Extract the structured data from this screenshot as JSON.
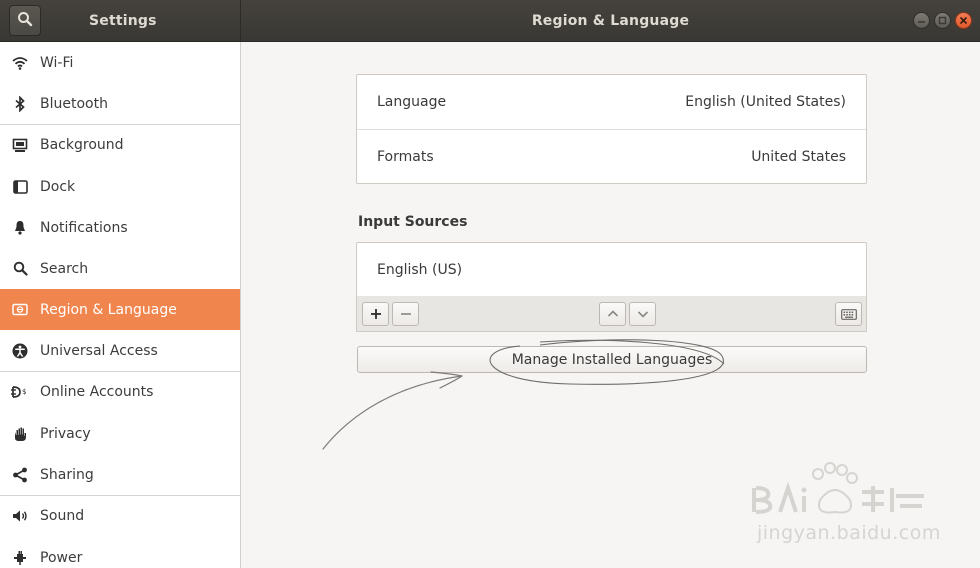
{
  "header": {
    "sidebar_title": "Settings",
    "title": "Region & Language"
  },
  "sidebar": {
    "items": [
      {
        "label": "Wi-Fi",
        "icon": "wifi-icon"
      },
      {
        "label": "Bluetooth",
        "icon": "bluetooth-icon"
      },
      {
        "label": "Background",
        "icon": "background-icon"
      },
      {
        "label": "Dock",
        "icon": "dock-icon"
      },
      {
        "label": "Notifications",
        "icon": "bell-icon"
      },
      {
        "label": "Search",
        "icon": "search-icon"
      },
      {
        "label": "Region & Language",
        "icon": "region-icon",
        "active": true
      },
      {
        "label": "Universal Access",
        "icon": "accessibility-icon"
      },
      {
        "label": "Online Accounts",
        "icon": "online-accounts-icon"
      },
      {
        "label": "Privacy",
        "icon": "hand-icon"
      },
      {
        "label": "Sharing",
        "icon": "share-icon"
      },
      {
        "label": "Sound",
        "icon": "speaker-icon"
      },
      {
        "label": "Power",
        "icon": "power-plug-icon"
      }
    ]
  },
  "main": {
    "language_label": "Language",
    "language_value": "English (United States)",
    "formats_label": "Formats",
    "formats_value": "United States",
    "input_sources_title": "Input Sources",
    "input_sources": [
      "English (US)"
    ],
    "manage_button": "Manage Installed Languages"
  },
  "watermark": {
    "text": "jingyan.baidu.com"
  },
  "colors": {
    "accent": "#f0854e",
    "header": "#3e3c38"
  }
}
